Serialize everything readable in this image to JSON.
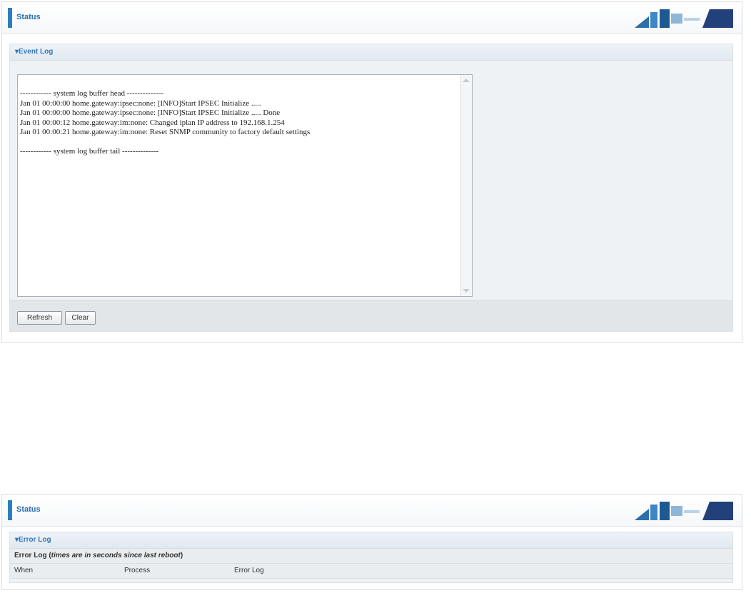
{
  "top_panel": {
    "header_title": "Status",
    "section_title": "▾Event Log",
    "log_text": "------------ system log buffer head --------------\nJan 01 00:00:00 home.gateway:ipsec:none: [INFO]Start IPSEC Initialize .....\nJan 01 00:00:00 home.gateway:ipsec:none: [INFO]Start IPSEC Initialize ..... Done\nJan 01 00:00:12 home.gateway:im:none: Changed iplan IP address to 192.168.1.254\nJan 01 00:00:21 home.gateway:im:none: Reset SNMP community to factory default settings\n\n------------ system log buffer tail --------------",
    "buttons": {
      "refresh": "Refresh",
      "clear": "Clear"
    }
  },
  "bottom_panel": {
    "header_title": "Status",
    "section_title": "▾Error Log",
    "table_title_prefix": "Error Log (",
    "table_title_italic": "times are in seconds since last reboot",
    "table_title_suffix": ")",
    "columns": [
      "When",
      "Process",
      "Error Log"
    ]
  },
  "colors": {
    "accent": "#2a7fc0",
    "section_title": "#3377bb"
  }
}
